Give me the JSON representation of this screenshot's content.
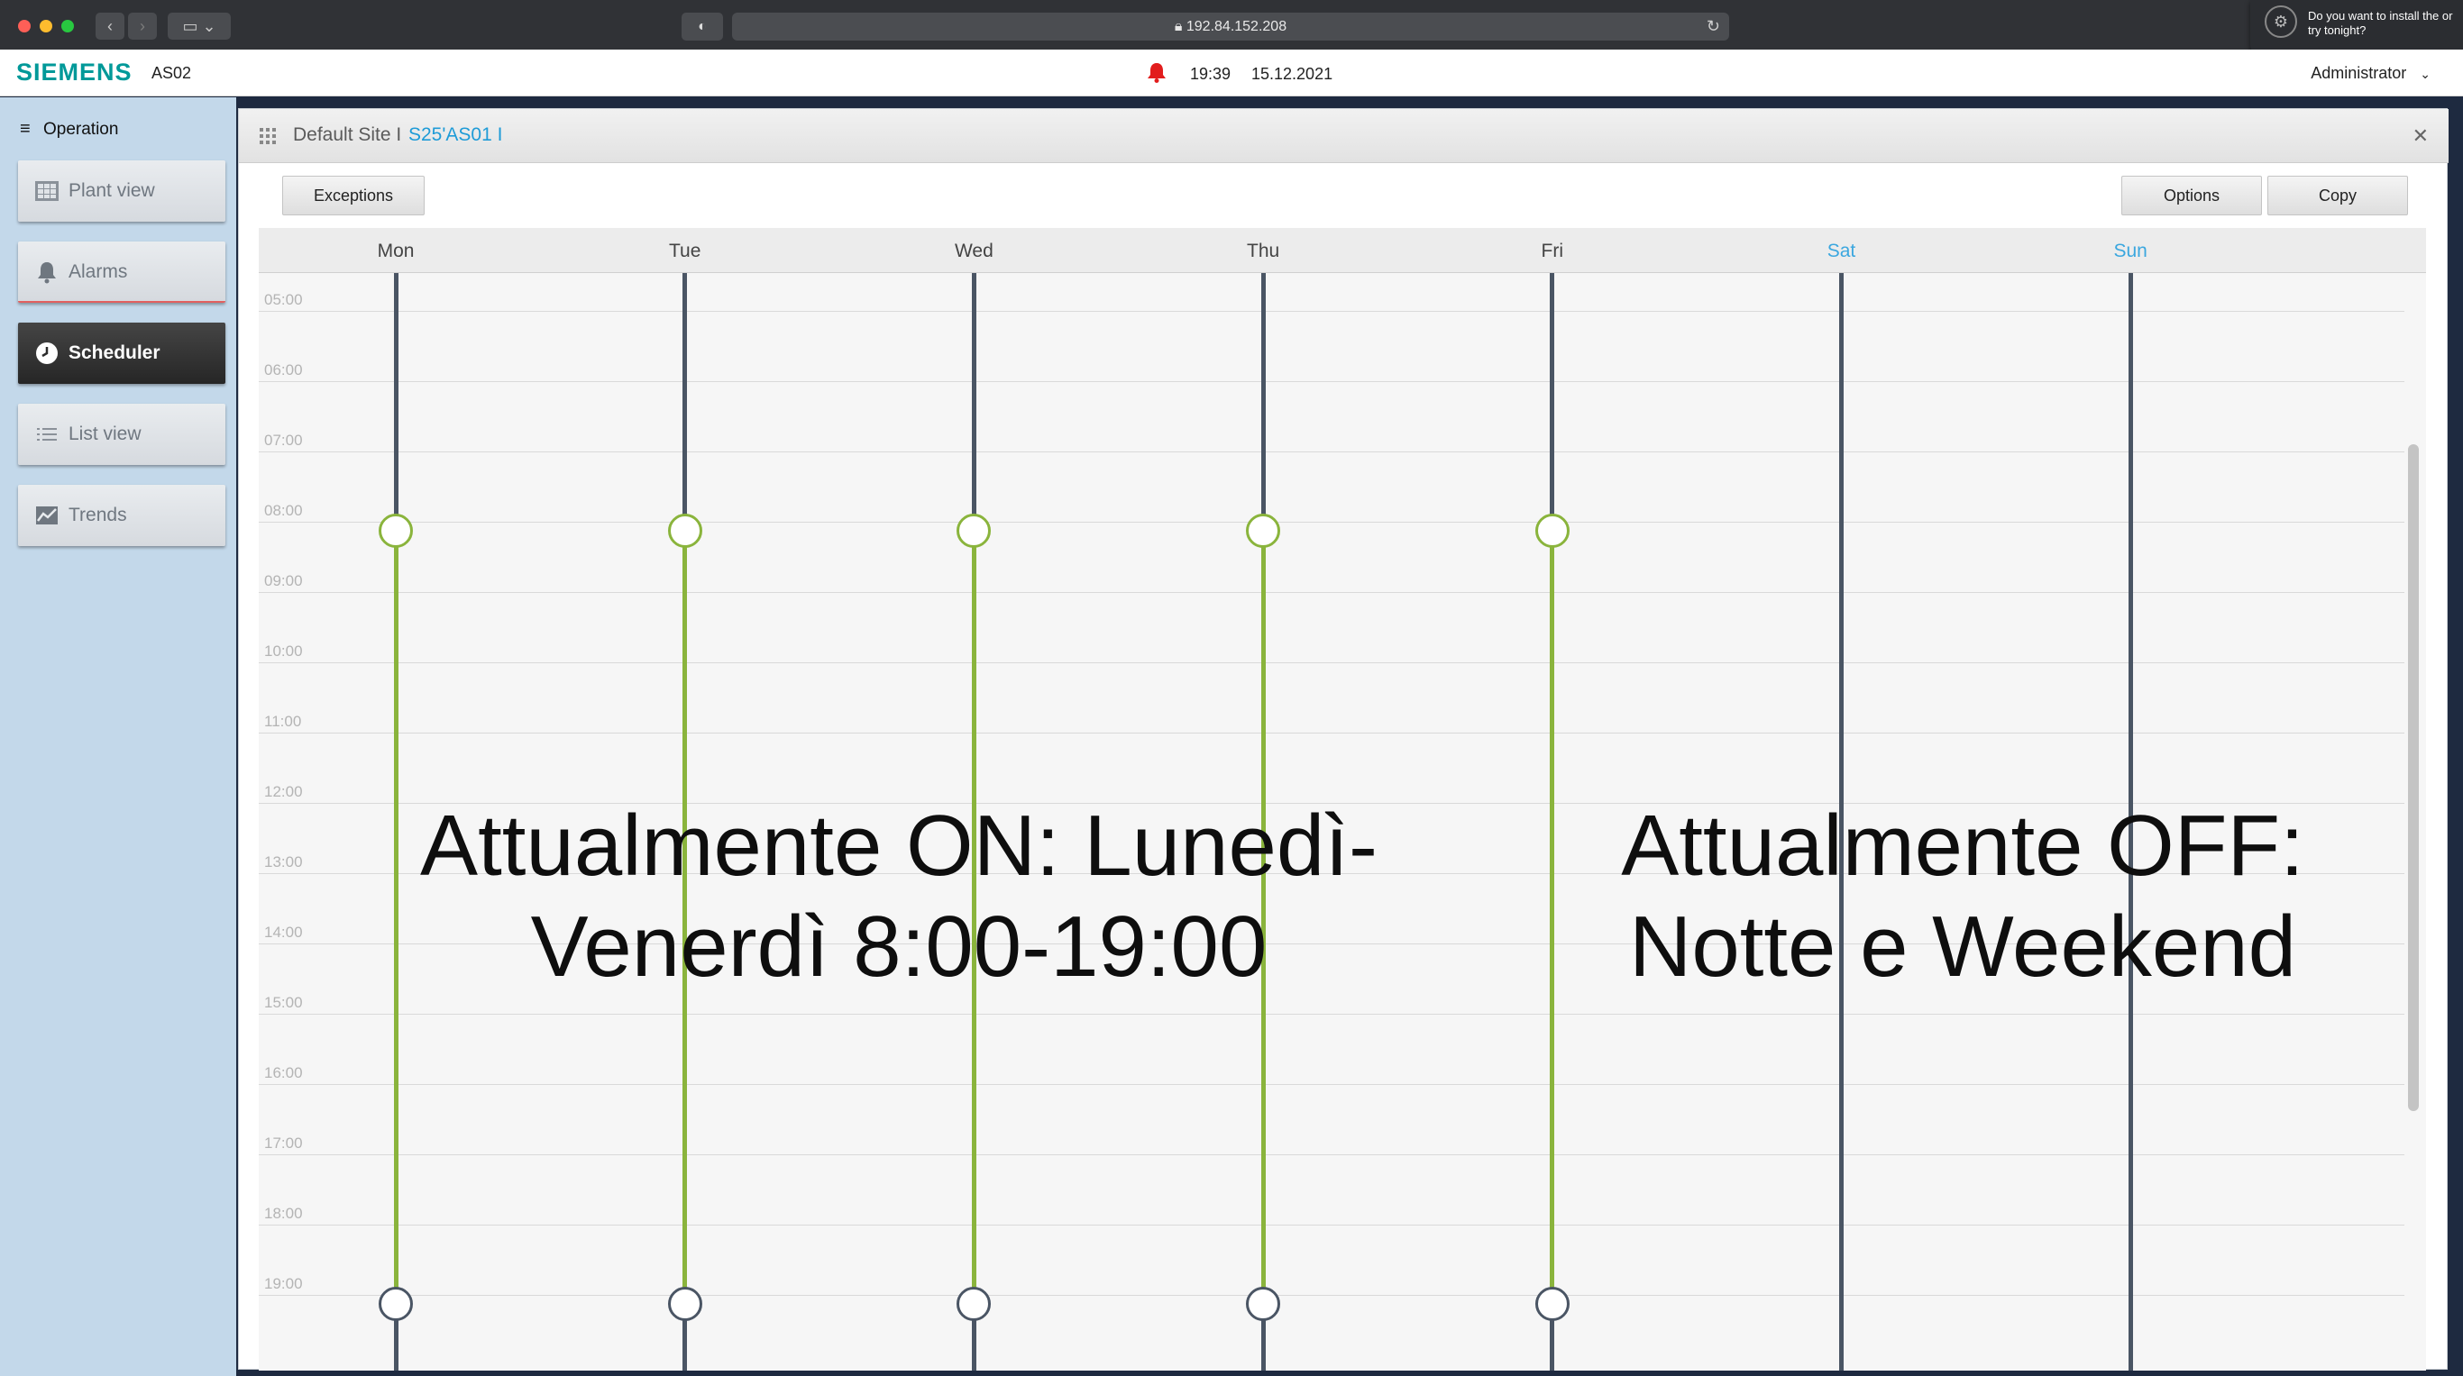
{
  "browser": {
    "url": "192.84.152.208",
    "notification": "Do you want to install the or try tonight?"
  },
  "header": {
    "brand": "SIEMENS",
    "device": "AS02",
    "time": "19:39",
    "date": "15.12.2021",
    "user": "Administrator"
  },
  "sidebar": {
    "section": "Operation",
    "items": [
      {
        "label": "Plant view",
        "icon": "grid-icon"
      },
      {
        "label": "Alarms",
        "icon": "bell-icon"
      },
      {
        "label": "Scheduler",
        "icon": "clock-icon",
        "active": true
      },
      {
        "label": "List view",
        "icon": "list-icon"
      },
      {
        "label": "Trends",
        "icon": "chart-icon"
      }
    ]
  },
  "breadcrumb": {
    "site": "Default Site I",
    "device": "S25'AS01 I"
  },
  "toolbar": {
    "exceptions": "Exceptions",
    "options": "Options",
    "copy": "Copy"
  },
  "scheduler": {
    "days": [
      "Mon",
      "Tue",
      "Wed",
      "Thu",
      "Fri",
      "Sat",
      "Sun"
    ],
    "weekend_days": [
      "Sat",
      "Sun"
    ],
    "hours": [
      "05:00",
      "06:00",
      "07:00",
      "08:00",
      "09:00",
      "10:00",
      "11:00",
      "12:00",
      "13:00",
      "14:00",
      "15:00",
      "16:00",
      "17:00",
      "18:00",
      "19:00"
    ],
    "on_time": "08:00",
    "off_time": "19:00",
    "on_color": "#8ab43c",
    "off_color": "#4a5564"
  },
  "annotations": {
    "on_text_line1": "Attualmente ON: Lunedì-",
    "on_text_line2": "Venerdì 8:00-19:00",
    "off_text_line1": "Attualmente OFF:",
    "off_text_line2": "Notte e Weekend"
  }
}
